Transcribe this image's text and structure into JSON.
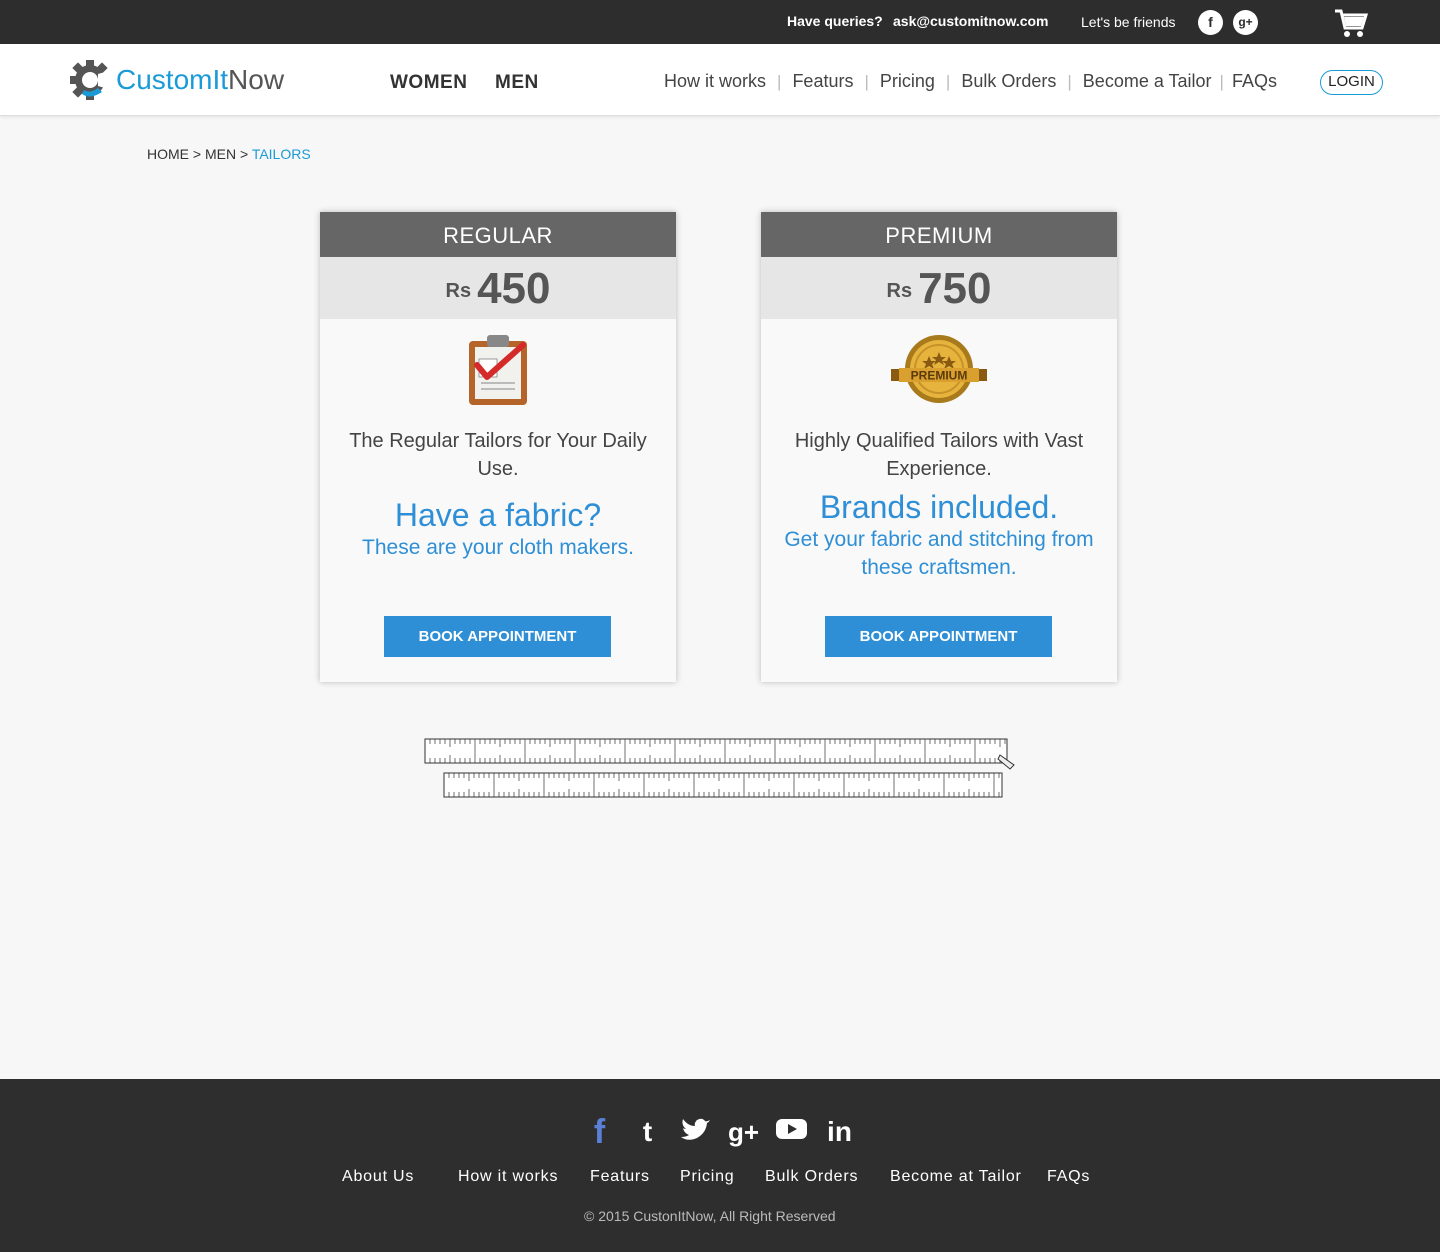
{
  "topbar": {
    "queries_label": "Have queries?",
    "email": "ask@customitnow.com",
    "friends_label": "Let's be friends",
    "facebook_glyph": "f",
    "googleplus_glyph": "g+"
  },
  "header": {
    "logo_part1": "CustomIt",
    "logo_part2": "Now",
    "nav_women": "WOMEN",
    "nav_men": "MEN",
    "right_nav": [
      "How it works",
      "Featurs",
      "Pricing",
      "Bulk Orders",
      "Become a Tailor",
      "FAQs"
    ],
    "login": "LOGIN"
  },
  "breadcrumb": {
    "home": "HOME",
    "men": "MEN",
    "current": "TAILORS",
    "sep": ">"
  },
  "cards": [
    {
      "title": "REGULAR",
      "currency": "Rs",
      "price": "450",
      "icon": "clipboard-check-icon",
      "description": "The Regular Tailors for Your Daily Use.",
      "headline": "Have a fabric?",
      "subline": "These are your cloth makers.",
      "button": "BOOK APPOINTMENT"
    },
    {
      "title": "PREMIUM",
      "currency": "Rs",
      "price": "750",
      "icon": "premium-badge-icon",
      "badge_text": "PREMIUM",
      "description": "Highly Qualified Tailors with Vast Experience.",
      "headline": "Brands included.",
      "subline": "Get your fabric and stitching from these craftsmen.",
      "button": "BOOK APPOINTMENT"
    }
  ],
  "footer": {
    "social_icons": [
      "facebook-icon",
      "tumblr-icon",
      "twitter-icon",
      "googleplus-icon",
      "youtube-icon",
      "linkedin-icon"
    ],
    "social_glyphs": {
      "fb": "f",
      "tumblr": "t",
      "gplus": "g+",
      "linkedin": "in"
    },
    "links": [
      "About Us",
      "How it works",
      "Featurs",
      "Pricing",
      "Bulk Orders",
      "Become at Tailor",
      "FAQs"
    ],
    "copyright": "© 2015 CustonItNow, All Right Reserved"
  },
  "colors": {
    "accent": "#2e8fd6",
    "topbar_bg": "#2d2d2d",
    "footer_bg": "#2e2e2e",
    "card_head_bg": "#666666"
  }
}
